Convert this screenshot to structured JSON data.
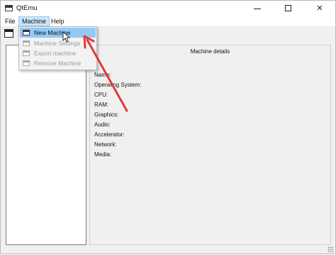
{
  "window": {
    "title": "QtEmu",
    "controls": {
      "minimize": "—",
      "maximize": "□",
      "close": "✕"
    }
  },
  "menubar": {
    "items": [
      {
        "label": "File"
      },
      {
        "label": "Machine"
      },
      {
        "label": "Help"
      }
    ]
  },
  "machine_menu": {
    "items": [
      {
        "label": "New Machine",
        "enabled": true,
        "highlighted": true,
        "icon": "new-machine-icon"
      },
      {
        "label": "Machine Settings",
        "enabled": false,
        "icon": "settings-icon"
      },
      {
        "label": "Export machine",
        "enabled": false,
        "icon": "export-icon"
      },
      {
        "label": "Remove Machine",
        "enabled": false,
        "icon": "remove-icon"
      }
    ]
  },
  "details": {
    "title": "Machine details",
    "labels": [
      "Name:",
      "Operating System:",
      "CPU:",
      "RAM:",
      "Graphics:",
      "Audio:",
      "Accelerator:",
      "Network:",
      "Media:"
    ]
  },
  "colors": {
    "menu_highlight": "#91c9f7",
    "menubar_highlight": "#cce4f7",
    "annotation_arrow": "#e03a3a",
    "disabled_text": "#9a9a9a"
  }
}
